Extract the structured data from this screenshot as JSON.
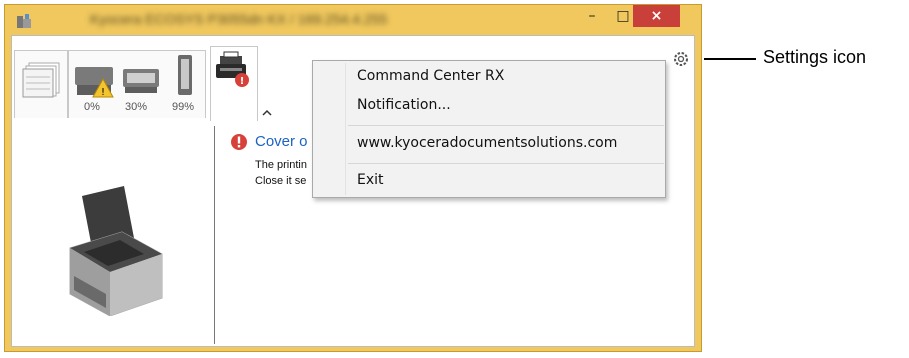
{
  "window": {
    "title": "Kyocera ECOSYS P3055dn KX / 169.254.4.255",
    "minimize_symbol": "–",
    "maximize_symbol": "□",
    "close_symbol": "×"
  },
  "tabs": {
    "toner_levels": [
      "0%",
      "30%",
      "99%"
    ]
  },
  "status": {
    "title": "Cover o",
    "line1": "The printin",
    "line2": "Close it se"
  },
  "menu": {
    "items": [
      "Command Center RX",
      "Notification...",
      "www.kyoceradocumentsolutions.com",
      "Exit"
    ]
  },
  "callout": {
    "label": "Settings icon"
  },
  "colors": {
    "frame": "#f0c85e",
    "close": "#c9403a",
    "alert": "#d8403a",
    "link_title": "#1c62c6"
  },
  "icons": [
    "app-icon",
    "paper-stack-icon",
    "toner-warning-icon",
    "toner-icon",
    "toner-tall-icon",
    "printer-alert-icon",
    "collapse-chevron-icon",
    "gear-icon",
    "alert-icon"
  ]
}
